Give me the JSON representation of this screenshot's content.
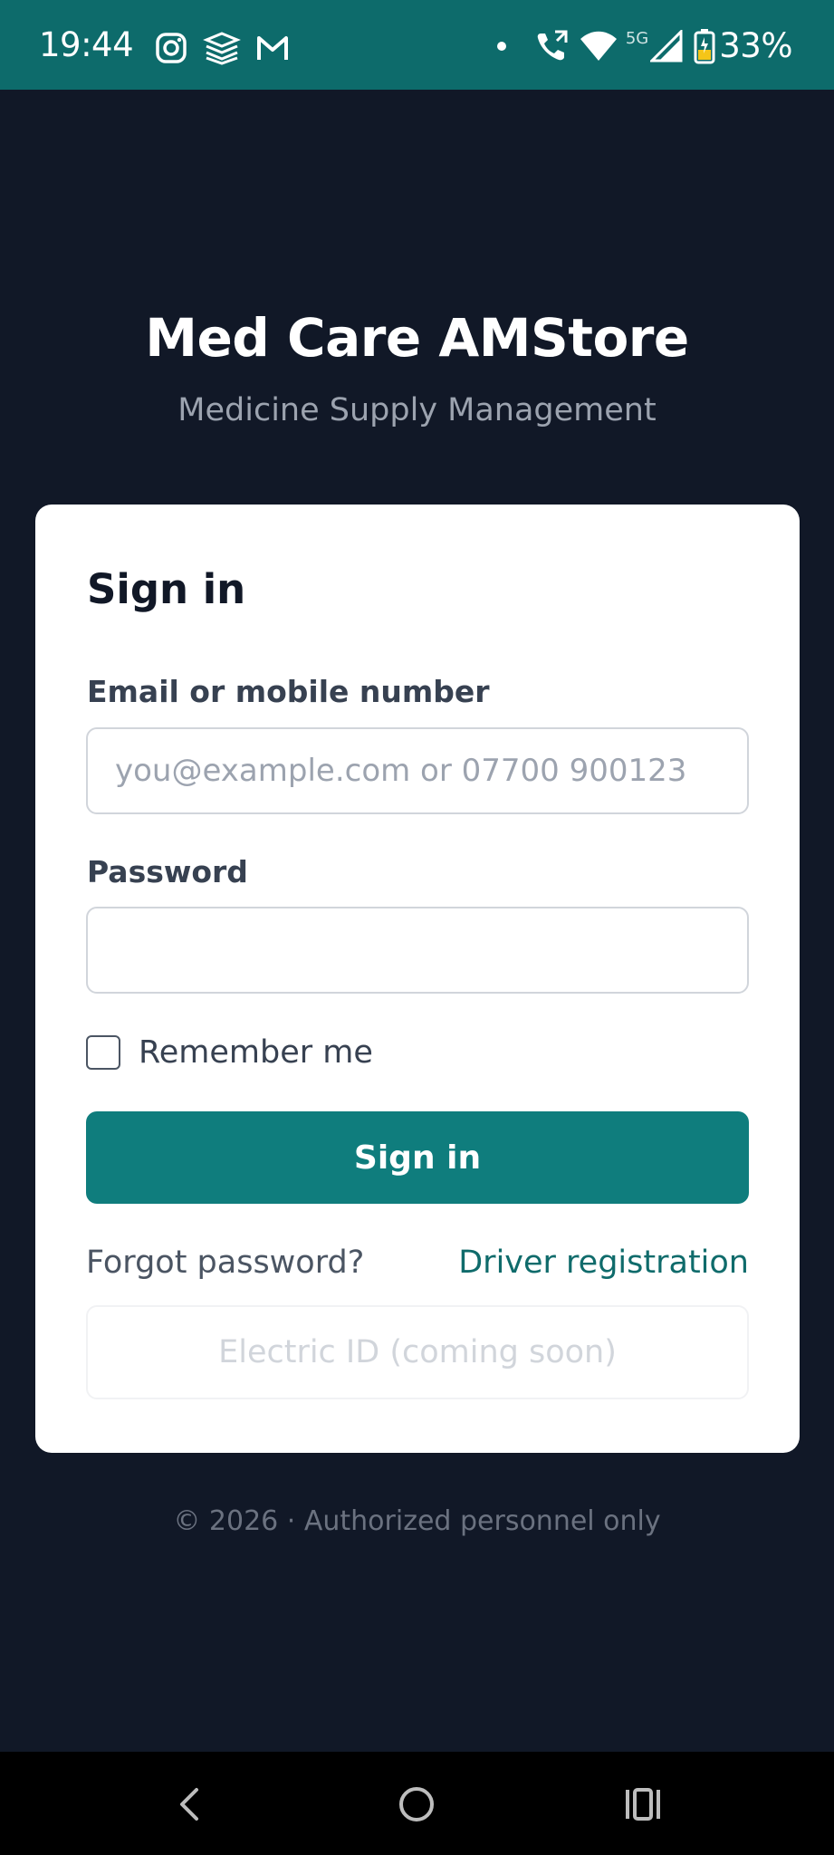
{
  "status_bar": {
    "time": "19:44",
    "network_type": "5G",
    "battery": "33%",
    "background_color": "#0d6b6b",
    "left_icons": [
      "instagram-icon",
      "stack-app-icon",
      "gmail-icon"
    ],
    "right_icons": [
      "notification-dot-icon",
      "wifi-calling-icon",
      "wifi-icon",
      "signal-icon",
      "battery-charging-icon"
    ]
  },
  "header": {
    "title": "Med Care AMStore",
    "subtitle": "Medicine Supply Management"
  },
  "sign_in_card": {
    "title": "Sign in",
    "email_label": "Email or mobile number",
    "email_placeholder": "you@example.com or 07700 900123",
    "password_label": "Password",
    "remember_label": "Remember me",
    "submit_label": "Sign in",
    "forgot_link": "Forgot password?",
    "driver_link": "Driver registration",
    "electric_id_label": "Electric ID (coming soon)"
  },
  "footer": {
    "text": "© 2026 · Authorized personnel only"
  },
  "nav_bar": {
    "buttons": [
      "back-icon",
      "home-icon",
      "recents-icon"
    ]
  },
  "colors": {
    "page_background": "#111827",
    "primary": "#0f7d7d",
    "link": "#0f6b6b"
  }
}
